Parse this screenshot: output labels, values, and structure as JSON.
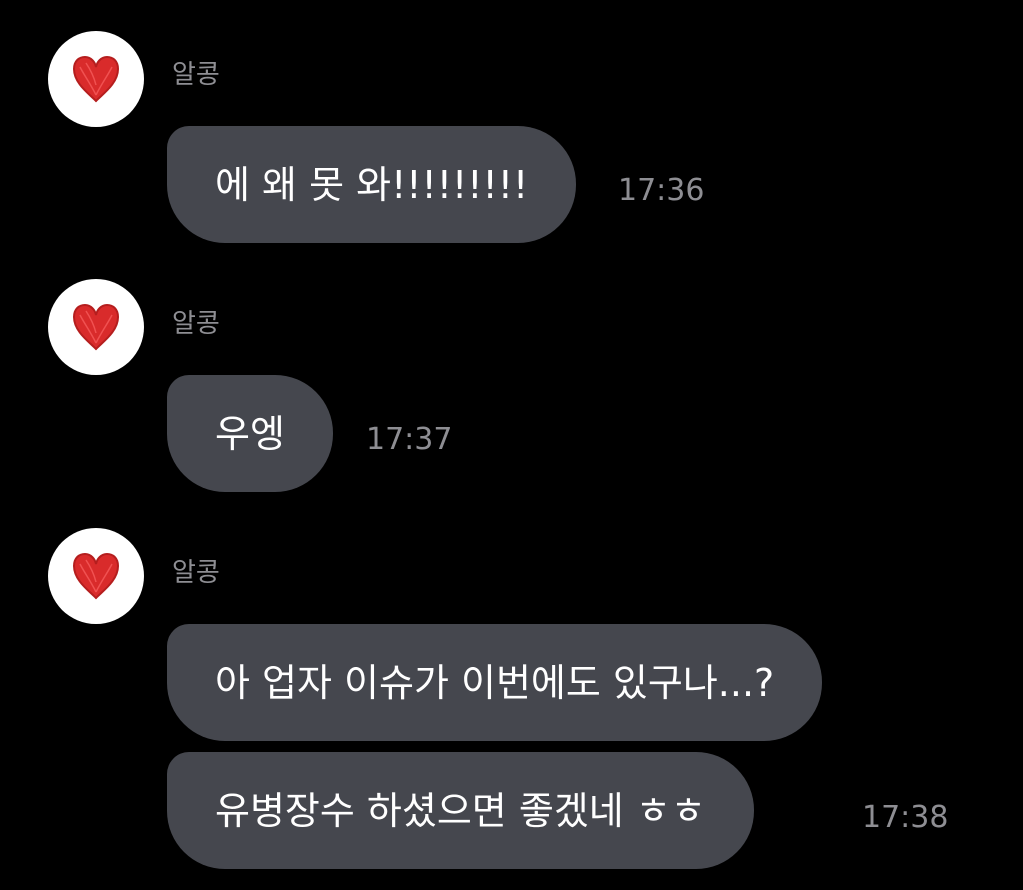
{
  "sender_name": "알콩",
  "avatar_icon": "heart-icon",
  "accent_color": "#d92b2b",
  "messages": [
    {
      "text": "에 왜 못 와!!!!!!!!!",
      "time": "17:36"
    },
    {
      "text": "우엥",
      "time": "17:37"
    },
    {
      "text": "아 업자 이슈가 이번에도 있구나...?"
    },
    {
      "text": "유병장수 하셨으면 좋겠네 ㅎㅎ",
      "time": "17:38"
    }
  ]
}
